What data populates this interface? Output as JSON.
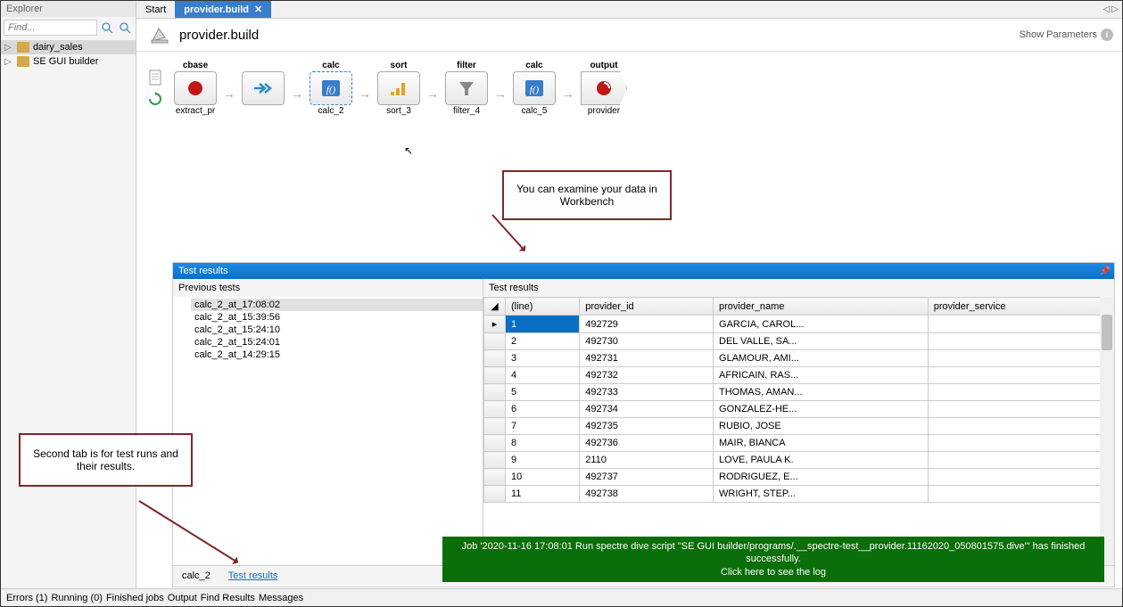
{
  "sidebar": {
    "title": "Explorer",
    "find_placeholder": "Find...",
    "items": [
      {
        "label": "dairy_sales",
        "selected": true
      },
      {
        "label": "SE GUI builder",
        "selected": false
      }
    ]
  },
  "tabs": [
    {
      "label": "Start",
      "active": false
    },
    {
      "label": "provider.build",
      "active": true
    }
  ],
  "page": {
    "title": "provider.build",
    "show_params": "Show Parameters"
  },
  "workflow": [
    {
      "title": "cbase",
      "label": "extract_pr",
      "kind": "cbase"
    },
    {
      "title": "",
      "label": "",
      "kind": "forward"
    },
    {
      "title": "calc",
      "label": "calc_2",
      "kind": "calc",
      "selected": true
    },
    {
      "title": "sort",
      "label": "sort_3",
      "kind": "sort"
    },
    {
      "title": "filter",
      "label": "filter_4",
      "kind": "filter"
    },
    {
      "title": "calc",
      "label": "calc_5",
      "kind": "calc"
    },
    {
      "title": "output",
      "label": "provider",
      "kind": "output"
    }
  ],
  "callouts": {
    "examine": "You can examine your data in Workbench",
    "second_tab": "Second tab is for test runs and their results."
  },
  "test_panel": {
    "title": "Test results",
    "previous_label": "Previous tests",
    "results_label": "Test results",
    "previous": [
      "calc_2_at_17:08:02",
      "calc_2_at_15:39:56",
      "calc_2_at_15:24:10",
      "calc_2_at_15:24:01",
      "calc_2_at_14:29:15"
    ],
    "columns": [
      "(line)",
      "provider_id",
      "provider_name",
      "provider_service"
    ],
    "rows": [
      {
        "line": "1",
        "provider_id": "492729",
        "provider_name": "GARCIA, CAROL...",
        "provider_service": ""
      },
      {
        "line": "2",
        "provider_id": "492730",
        "provider_name": "DEL VALLE, SA...",
        "provider_service": ""
      },
      {
        "line": "3",
        "provider_id": "492731",
        "provider_name": "GLAMOUR, AMI...",
        "provider_service": ""
      },
      {
        "line": "4",
        "provider_id": "492732",
        "provider_name": "AFRICAIN, RAS...",
        "provider_service": ""
      },
      {
        "line": "5",
        "provider_id": "492733",
        "provider_name": "THOMAS, AMAN...",
        "provider_service": ""
      },
      {
        "line": "6",
        "provider_id": "492734",
        "provider_name": "GONZALEZ-HE...",
        "provider_service": ""
      },
      {
        "line": "7",
        "provider_id": "492735",
        "provider_name": "RUBIO, JOSE",
        "provider_service": ""
      },
      {
        "line": "8",
        "provider_id": "492736",
        "provider_name": "MAIR, BIANCA",
        "provider_service": ""
      },
      {
        "line": "9",
        "provider_id": "2110",
        "provider_name": "LOVE, PAULA K.",
        "provider_service": ""
      },
      {
        "line": "10",
        "provider_id": "492737",
        "provider_name": "RODRIGUEZ, E...",
        "provider_service": ""
      },
      {
        "line": "11",
        "provider_id": "492738",
        "provider_name": "WRIGHT, STEP...",
        "provider_service": ""
      }
    ],
    "bottom_tabs": [
      {
        "label": "calc_2",
        "active": false
      },
      {
        "label": "Test results",
        "active": true
      }
    ]
  },
  "toast": {
    "line1": "Job '2020-11-16 17:08:01 Run spectre dive script \"SE GUI builder/programs/.__spectre-test__provider.11162020_050801575.dive\"' has finished successfully.",
    "line2": "Click here to see the log"
  },
  "statusbar": [
    "Errors (1)",
    "Running (0)",
    "Finished jobs",
    "Output",
    "Find Results",
    "Messages"
  ]
}
